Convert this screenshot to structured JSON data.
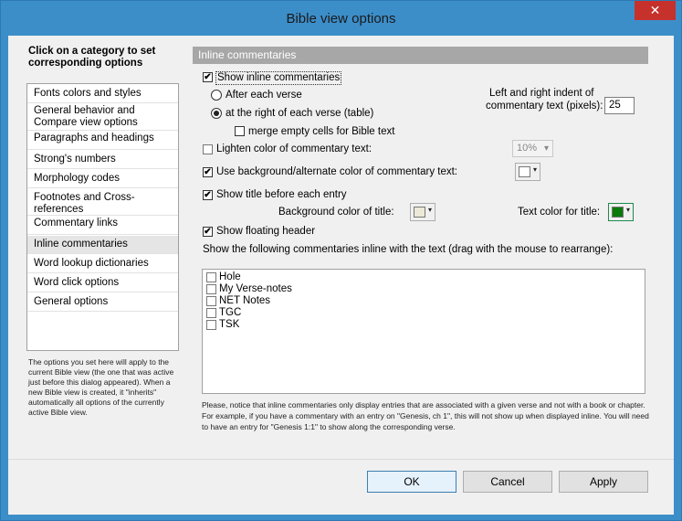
{
  "window": {
    "title": "Bible view options",
    "close_glyph": "✕"
  },
  "left": {
    "heading": "Click on a category to set corresponding options",
    "categories": [
      "Fonts colors and styles",
      "General behavior and Compare view options",
      "Paragraphs and headings",
      "Strong's numbers",
      "Morphology codes",
      "Footnotes and Cross-references",
      "Commentary links",
      "Inline commentaries",
      "Word lookup dictionaries",
      "Word click options",
      "General options"
    ],
    "selected": "Inline commentaries",
    "note": "The options you set here will apply to the current Bible view (the one that was active just before this dialog appeared). When a new Bible view is created, it \"inherits\" automatically all options of the currently active Bible view."
  },
  "panel": {
    "header": "Inline commentaries",
    "show_inline": {
      "label": "Show inline commentaries",
      "checked": true
    },
    "after_each_verse": {
      "label": "After each verse",
      "selected": false
    },
    "at_right": {
      "label": "at the right of each verse (table)",
      "selected": true
    },
    "merge_empty": {
      "label": "merge empty cells for Bible text",
      "checked": false
    },
    "indent_label_1": "Left and right indent of",
    "indent_label_2": "commentary text (pixels):",
    "indent_value": "25",
    "lighten": {
      "label": "Lighten color of commentary text:",
      "checked": false
    },
    "lighten_value": "10%",
    "use_background": {
      "label": "Use background/alternate color of commentary text:",
      "checked": true
    },
    "show_title": {
      "label": "Show title before each entry",
      "checked": true
    },
    "bg_color_title_label": "Background color of title:",
    "text_color_title_label": "Text color for title:",
    "show_floating": {
      "label": "Show floating header",
      "checked": true
    },
    "list_instruction": "Show the following commentaries inline with the text (drag with the mouse to rearrange):",
    "commentaries": [
      "Hole",
      "My Verse-notes",
      "NET Notes",
      "TGC",
      "TSK"
    ],
    "bottom_note": "Please, notice that inline commentaries only display entries that are associated with a given verse and not with a book or chapter. For example, if you have a commentary with an entry on \"Genesis, ch 1\", this will not show up when displayed inline. You will need to have an entry for \"Genesis 1:1\" to show along the corresponding verse."
  },
  "buttons": {
    "ok": "OK",
    "cancel": "Cancel",
    "apply": "Apply"
  },
  "colors": {
    "accent": "#3c8ec9",
    "title_text_color": "#0a7a0a",
    "background_swatch": "#ffffff",
    "title_bg_swatch": "#ece9d8"
  },
  "icons": {
    "check": "✔",
    "dropdown": "▾"
  }
}
